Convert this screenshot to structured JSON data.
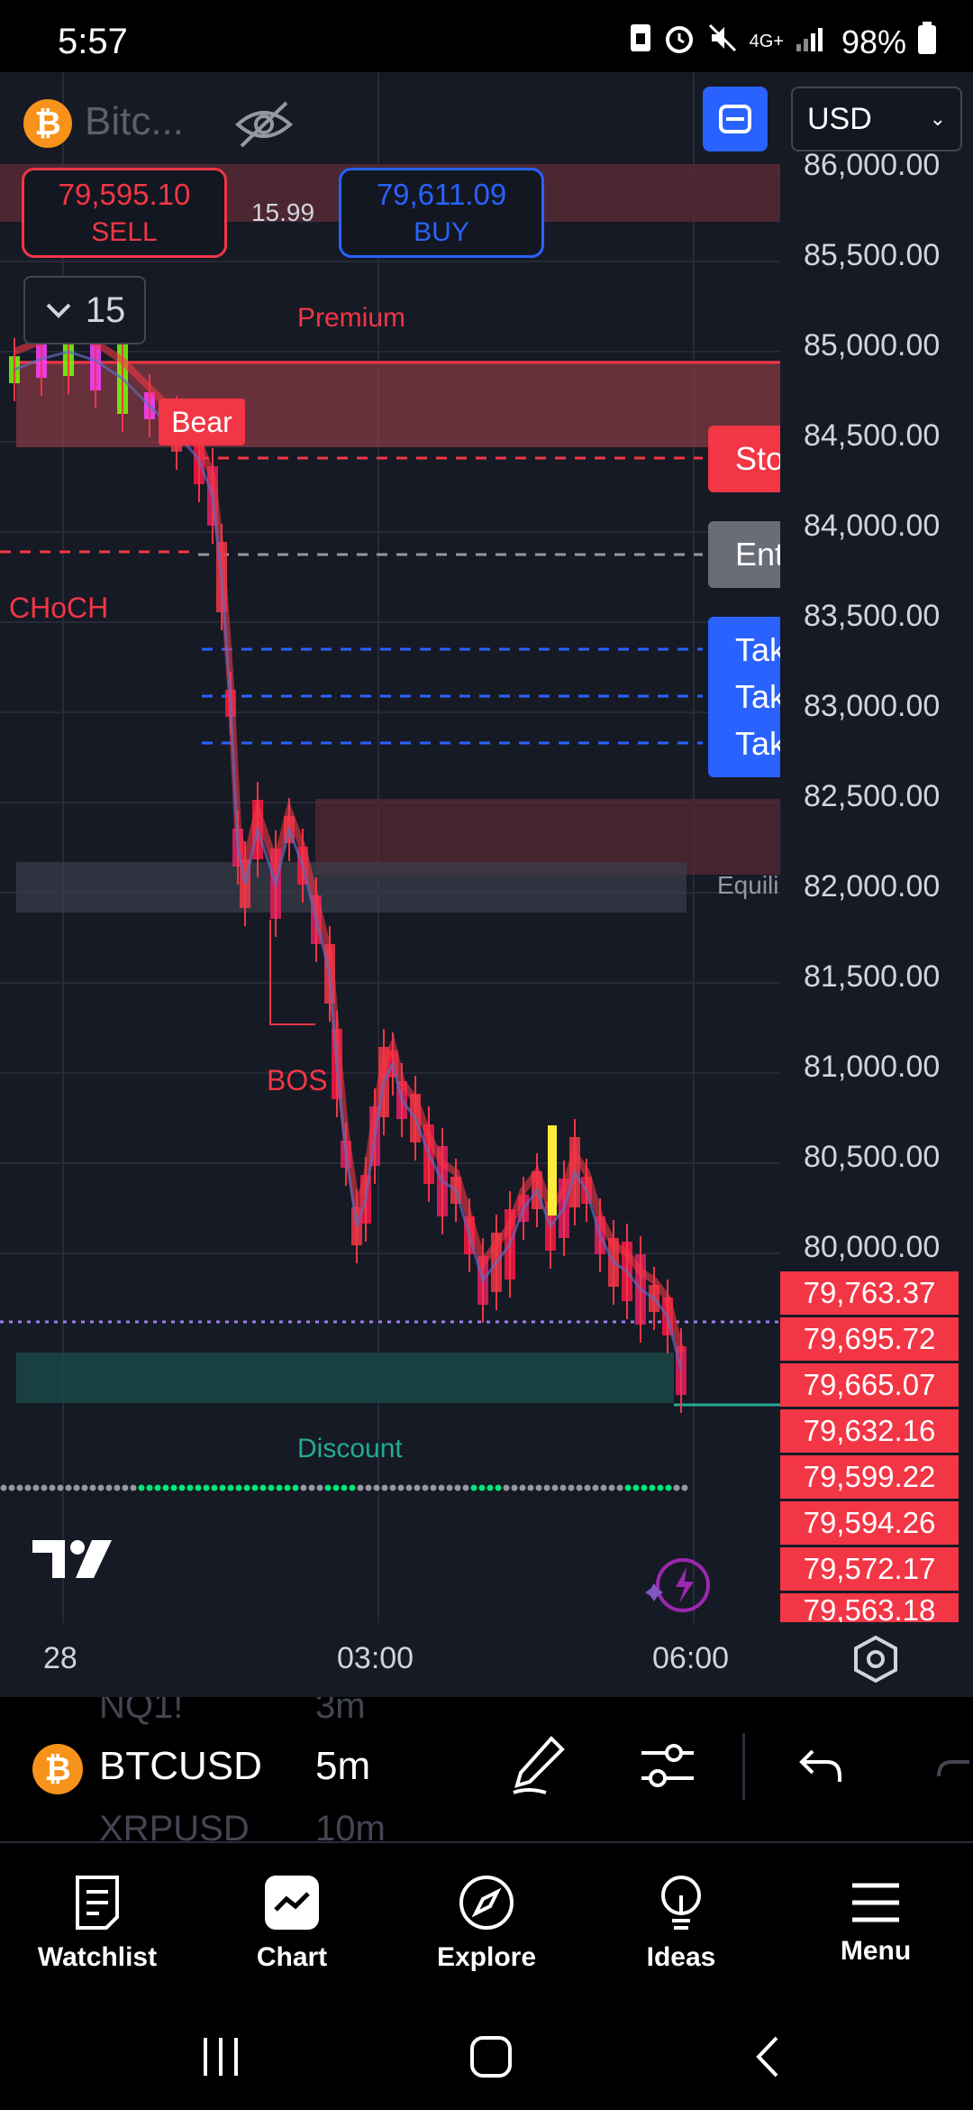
{
  "status_bar": {
    "time": "5:57",
    "network": "4G+",
    "battery": "98%"
  },
  "header": {
    "coin_symbol": "₿",
    "symbol_short": "Bitc...",
    "currency": "USD"
  },
  "trade": {
    "sell_price": "79,595.10",
    "sell_label": "SELL",
    "buy_price": "79,611.09",
    "buy_label": "BUY",
    "spread": "15.99"
  },
  "interval": {
    "value": "15"
  },
  "chart": {
    "price_axis": [
      "86,000.00",
      "85,500.00",
      "85,000.00",
      "84,500.00",
      "84,000.00",
      "83,500.00",
      "83,000.00",
      "82,500.00",
      "82,000.00",
      "81,500.00",
      "81,000.00",
      "80,500.00",
      "80,000.00"
    ],
    "price_tags": [
      "79,763.37",
      "79,695.72",
      "79,665.07",
      "79,632.16",
      "79,599.22",
      "79,594.26",
      "79,572.17",
      "79,563.18"
    ],
    "annotations": {
      "premium": "Premium",
      "discount": "Discount",
      "bear": "Bear",
      "choch": "CHoCH",
      "bos": "BOS",
      "equilibrium": "Equili"
    },
    "line_labels": {
      "stop": "Sto",
      "entry": "Ent",
      "tp1": "Tak",
      "tp2": "Tak",
      "tp3": "Tak"
    },
    "time_axis": [
      "28",
      "03:00",
      "06:00"
    ],
    "colors": {
      "bear": "#f23645",
      "bull": "#2962ff",
      "background": "#161a25"
    }
  },
  "toolbar": {
    "symbol": "BTCUSD",
    "symbol_above": "NQ1!",
    "symbol_below": "XRPUSD",
    "timeframe": "5m",
    "timeframe_above": "3m",
    "timeframe_below": "10m"
  },
  "bottom_nav": {
    "items": [
      {
        "label": "Watchlist",
        "icon": "watchlist-icon"
      },
      {
        "label": "Chart",
        "icon": "chart-icon"
      },
      {
        "label": "Explore",
        "icon": "compass-icon"
      },
      {
        "label": "Ideas",
        "icon": "lightbulb-icon"
      },
      {
        "label": "Menu",
        "icon": "menu-icon"
      }
    ]
  }
}
